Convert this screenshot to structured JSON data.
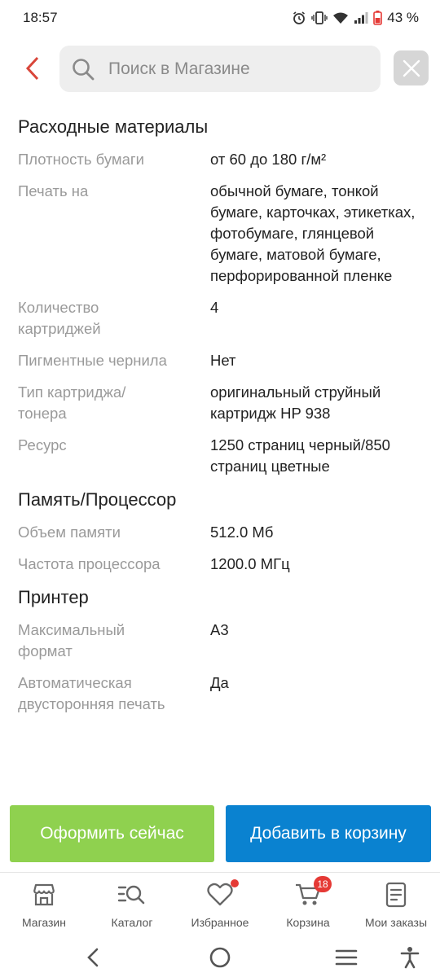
{
  "status": {
    "time": "18:57",
    "battery": "43 %"
  },
  "search": {
    "placeholder": "Поиск в Магазине"
  },
  "icons": {
    "back": "chevron-left-icon",
    "search": "search-icon",
    "clear": "close-icon"
  },
  "colors": {
    "accent_red": "#e53935",
    "buy_green": "#8fd14f",
    "cart_blue": "#0a82d0",
    "label_gray": "#9a9a9a"
  },
  "sections": [
    {
      "title": "Расходные материалы",
      "rows": [
        {
          "label": "Плотность бумаги",
          "value": "от 60 до 180 г/м²"
        },
        {
          "label": "Печать на",
          "value": "обычной бумаге, тонкой бумаге, карточках, этикетках, фотобумаге, глянцевой бумаге, матовой бумаге, перфорированной пленке"
        },
        {
          "label": "Количество картриджей",
          "value": "4"
        },
        {
          "label": "Пигментные чернила",
          "value": "Нет"
        },
        {
          "label": "Тип картриджа/ тонера",
          "value": "оригинальный струйный картридж HP 938"
        },
        {
          "label": "Ресурс",
          "value": "1250 страниц черный/850 страниц цветные"
        }
      ]
    },
    {
      "title": "Память/Процессор",
      "rows": [
        {
          "label": "Объем памяти",
          "value": "512.0 Мб"
        },
        {
          "label": "Частота процессора",
          "value": "1200.0 МГц"
        }
      ]
    },
    {
      "title": "Принтер",
      "rows": [
        {
          "label": "Максимальный формат",
          "value": "A3"
        },
        {
          "label": "Автоматическая двусторонняя печать",
          "value": "Да"
        }
      ]
    }
  ],
  "actions": {
    "buy_now": "Оформить сейчас",
    "add_to_cart": "Добавить в корзину"
  },
  "tabs": [
    {
      "label": "Магазин",
      "icon": "store-icon"
    },
    {
      "label": "Каталог",
      "icon": "catalog-search-icon"
    },
    {
      "label": "Избранное",
      "icon": "heart-icon"
    },
    {
      "label": "Корзина",
      "icon": "cart-icon",
      "badge": "18"
    },
    {
      "label": "Мои заказы",
      "icon": "orders-icon"
    }
  ],
  "system_nav": [
    "back-icon",
    "home-icon",
    "menu-icon",
    "accessibility-icon"
  ]
}
